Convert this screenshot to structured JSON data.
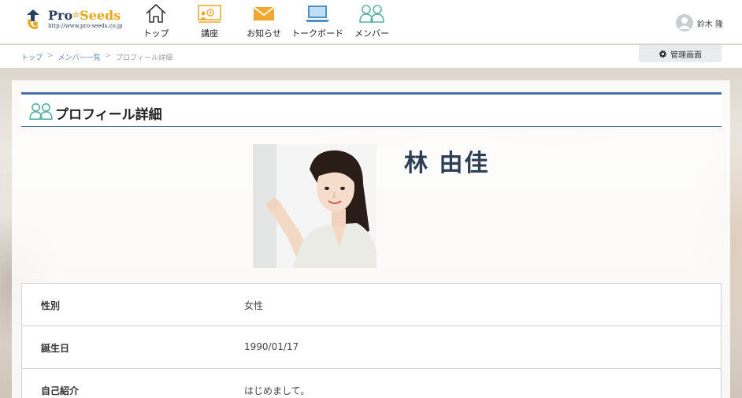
{
  "header": {
    "logo": {
      "brand_pro": "Pro",
      "brand_star": "☆",
      "brand_seeds": "Seeds",
      "url": "http://www.pro-seeds.co.jp"
    },
    "nav": [
      {
        "label": "トップ",
        "icon": "home-icon"
      },
      {
        "label": "講座",
        "icon": "course-icon"
      },
      {
        "label": "お知らせ",
        "icon": "mail-icon"
      },
      {
        "label": "トークボード",
        "icon": "laptop-icon"
      },
      {
        "label": "メンバー",
        "icon": "members-icon"
      }
    ],
    "user": {
      "name": "鈴木 隆",
      "icon": "avatar-icon"
    }
  },
  "breadcrumb": {
    "items": [
      "トップ",
      "メンバー一覧",
      "プロフィール詳細"
    ],
    "separator": ">"
  },
  "admin": {
    "label": "管理画面",
    "icon": "gear-icon"
  },
  "page": {
    "title": "プロフィール詳細",
    "title_icon": "members-icon"
  },
  "profile": {
    "name": "林 由佳",
    "fields": [
      {
        "label": "性別",
        "value": "女性"
      },
      {
        "label": "誕生日",
        "value": "1990/01/17"
      },
      {
        "label": "自己紹介",
        "value": "はじめまして。"
      }
    ]
  },
  "colors": {
    "accent": "#4e6ea8",
    "icon_teal": "#57b3a8",
    "icon_orange": "#f0a830",
    "icon_blue": "#4a93c9",
    "name_color": "#2d3e57"
  }
}
